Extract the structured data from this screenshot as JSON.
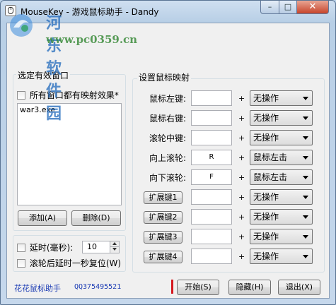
{
  "window": {
    "title": "MouseKey - 游戏鼠标助手 - Dandy",
    "min_symbol": "–",
    "max_symbol": "□",
    "close_symbol": "✕"
  },
  "watermark": {
    "site_name": "河东软件园",
    "url": "www.pc0359.cn"
  },
  "left_panel": {
    "title": "选定有效窗口",
    "all_windows_checkbox": {
      "label": "所有窗口都有映射效果*",
      "checked": false
    },
    "window_list": [
      "war3.exe"
    ],
    "add_button": "添加(A)",
    "delete_button": "删除(D)"
  },
  "options": {
    "delay_checkbox": {
      "label": "延时(毫秒):",
      "checked": false
    },
    "delay_value": "10",
    "wheel_reset_checkbox": {
      "label": "滚轮后延时一秒复位(W)",
      "checked": false
    }
  },
  "mapping_panel": {
    "title": "设置鼠标映射",
    "plus": "+",
    "rows": [
      {
        "label": "鼠标左键:",
        "key": "",
        "action": "无操作"
      },
      {
        "label": "鼠标右键:",
        "key": "",
        "action": "无操作"
      },
      {
        "label": "滚轮中键:",
        "key": "",
        "action": "无操作"
      },
      {
        "label": "向上滚轮:",
        "key": "R",
        "action": "鼠标左击"
      },
      {
        "label": "向下滚轮:",
        "key": "F",
        "action": "鼠标左击"
      },
      {
        "button": "扩展键1",
        "key": "",
        "action": "无操作"
      },
      {
        "button": "扩展键2",
        "key": "",
        "action": "无操作"
      },
      {
        "button": "扩展键3",
        "key": "",
        "action": "无操作"
      },
      {
        "button": "扩展键4",
        "key": "",
        "action": "无操作"
      }
    ]
  },
  "footer": {
    "brand": "花花鼠标助手",
    "qq": "QQ375495521",
    "start_button": "开始(S)",
    "hide_button": "隐藏(H)",
    "exit_button": "退出(X)",
    "accent_color": "#d51920"
  }
}
